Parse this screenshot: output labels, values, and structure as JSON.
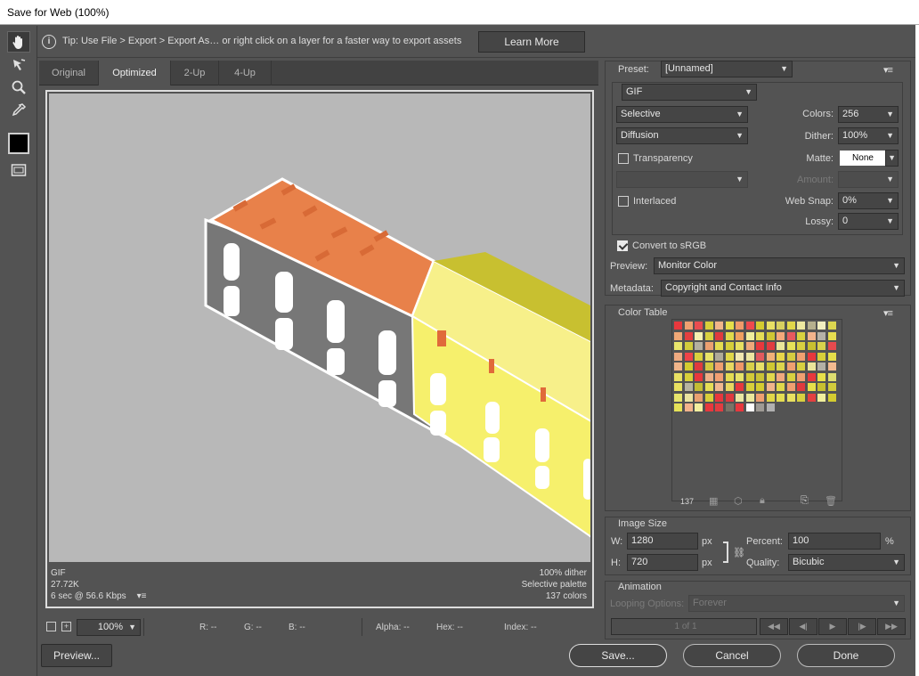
{
  "window": {
    "title": "Save for Web (100%)"
  },
  "tipbar": {
    "tip": "Tip: Use File > Export > Export As…  or right click on a layer for a faster way to export assets",
    "learn_more": "Learn More"
  },
  "tools": {
    "icons": [
      "hand-icon",
      "slice-select-icon",
      "zoom-icon",
      "eyedropper-icon"
    ],
    "swatch_color": "#000000"
  },
  "tabs": [
    {
      "label": "Original"
    },
    {
      "label": "Optimized",
      "active": true
    },
    {
      "label": "2-Up"
    },
    {
      "label": "4-Up"
    }
  ],
  "canvas_info": {
    "format": "GIF",
    "size": "27.72K",
    "time": "6 sec @ 56.6 Kbps",
    "dither": "100% dither",
    "palette": "Selective palette",
    "colors": "137 colors"
  },
  "statusbar": {
    "zoom": "100%",
    "r": "R: --",
    "g": "G: --",
    "b": "B: --",
    "alpha": "Alpha: --",
    "hex": "Hex: --",
    "index": "Index: --"
  },
  "preset": {
    "label": "Preset:",
    "value": "[Unnamed]"
  },
  "settings": {
    "format": "GIF",
    "reduction": "Selective",
    "dither_algo": "Diffusion",
    "transparency_label": "Transparency",
    "transparency_checked": false,
    "interlaced_label": "Interlaced",
    "interlaced_checked": false,
    "colors_label": "Colors:",
    "colors_value": "256",
    "dither_label": "Dither:",
    "dither_value": "100%",
    "matte_label": "Matte:",
    "matte_value": "None",
    "amount_label": "Amount:",
    "websnap_label": "Web Snap:",
    "websnap_value": "0%",
    "lossy_label": "Lossy:",
    "lossy_value": "0"
  },
  "convert": {
    "label": "Convert to sRGB",
    "checked": true
  },
  "preview": {
    "label": "Preview:",
    "value": "Monitor Color"
  },
  "metadata": {
    "label": "Metadata:",
    "value": "Copyright and Contact Info"
  },
  "color_table": {
    "title": "Color Table",
    "count": "137",
    "colors": [
      "#e8383d",
      "#f0a070",
      "#e94c50",
      "#d8cf3a",
      "#f1b58a",
      "#e6df4a",
      "#f19a6a",
      "#ef4a4e",
      "#d4cc30",
      "#e8e064",
      "#d8d060",
      "#e2d84a",
      "#eee9a0",
      "#b6b08e",
      "#f2efc0",
      "#dcd650",
      "#f0a876",
      "#e44040",
      "#f6f2b0",
      "#d8d140",
      "#e03a3e",
      "#dfd94a",
      "#f0a060",
      "#f0ee9c",
      "#e4dc56",
      "#cfc634",
      "#f5a87a",
      "#e85a5e",
      "#d8d240",
      "#f2b38c",
      "#b6b2a8",
      "#e6dd50",
      "#e8e56c",
      "#d2cc3c",
      "#b4b0a0",
      "#eba070",
      "#e4dc50",
      "#d6ce3a",
      "#e8e060",
      "#f0a87a",
      "#e8383d",
      "#e23c40",
      "#ebe89a",
      "#e6e258",
      "#d8d040",
      "#c8c030",
      "#d9d14c",
      "#e64a4e",
      "#f0aa80",
      "#ee4448",
      "#d9d03e",
      "#e8e468",
      "#b0aa98",
      "#e0d648",
      "#f2e8b0",
      "#ede7a0",
      "#e25a5e",
      "#f2b078",
      "#e8d64a",
      "#d6cc40",
      "#f0a070",
      "#e8383d",
      "#d8cf3a",
      "#e6df4a",
      "#f1b58a",
      "#d4cc30",
      "#e03a3e",
      "#d2c840",
      "#f0a070",
      "#e8d860",
      "#f09868",
      "#d8d04a",
      "#e8e068",
      "#cfc832",
      "#dcd64c",
      "#f0a070",
      "#d8d040",
      "#ebe59a",
      "#b4b0a6",
      "#f2ba90",
      "#e8e064",
      "#d8cf3a",
      "#e8383d",
      "#eeb088",
      "#f29f72",
      "#e3dc52",
      "#e6e268",
      "#d2ca38",
      "#c9c236",
      "#e0d84c",
      "#f1a87e",
      "#d8d140",
      "#f0a070",
      "#e8383d",
      "#e6df4a",
      "#dedd70",
      "#e8e060",
      "#b8b4a0",
      "#c4bc34",
      "#e6de56",
      "#f2b890",
      "#e8d860",
      "#e8383d",
      "#d8cf3a",
      "#d4cc30",
      "#f1b58a",
      "#dfd94a",
      "#f0a070",
      "#e03a3e",
      "#e6df4a",
      "#c8c030",
      "#d2cc3c",
      "#e8e56c",
      "#eae4a0",
      "#e8a070",
      "#d8cf3a",
      "#e8383d",
      "#e03a3e",
      "#eae6a2",
      "#ebe89a",
      "#f0a070",
      "#e0d648",
      "#e3dc52",
      "#e8e060",
      "#d8d040",
      "#e44040",
      "#f0ee9c",
      "#d4cc30",
      "#e6e258",
      "#f2b38c",
      "#f3ef9e",
      "#e8383d",
      "#e23c40",
      "#7a7366",
      "#e8383d",
      "#ffffff",
      "#9e9a94",
      "#b0b0b0"
    ]
  },
  "image_size": {
    "title": "Image Size",
    "w_label": "W:",
    "w_value": "1280",
    "w_unit": "px",
    "h_label": "H:",
    "h_value": "720",
    "h_unit": "px",
    "percent_label": "Percent:",
    "percent_value": "100",
    "percent_unit": "%",
    "quality_label": "Quality:",
    "quality_value": "Bicubic"
  },
  "animation": {
    "title": "Animation",
    "looping_label": "Looping Options:",
    "looping_value": "Forever",
    "frame": "1 of 1"
  },
  "buttons": {
    "preview": "Preview...",
    "save": "Save...",
    "cancel": "Cancel",
    "done": "Done"
  }
}
